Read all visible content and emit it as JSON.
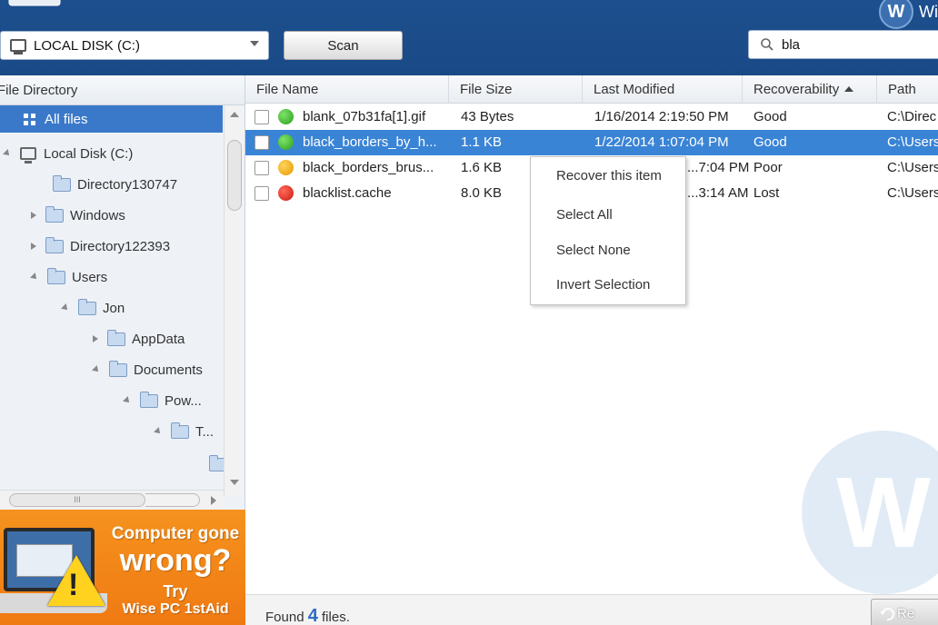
{
  "header": {
    "brand_badge": "W",
    "brand_name": "Wi",
    "drive_select": {
      "value": "LOCAL DISK (C:)"
    },
    "scan_label": "Scan",
    "search_value": "bla"
  },
  "sidebar": {
    "heading": "File Directory",
    "all_files": "All files",
    "tree": [
      {
        "label": "Local Disk (C:)"
      },
      {
        "label": "Directory130747"
      },
      {
        "label": "Windows"
      },
      {
        "label": "Directory122393"
      },
      {
        "label": "Users"
      },
      {
        "label": "Jon"
      },
      {
        "label": "AppData"
      },
      {
        "label": "Documents"
      },
      {
        "label": "Pow..."
      },
      {
        "label": "T..."
      }
    ],
    "hscroll_grip": "III"
  },
  "ad": {
    "line1": "Computer gone",
    "line2": "wrong?",
    "line3": "Try",
    "line4": "Wise PC 1stAid"
  },
  "table": {
    "columns": [
      "File Name",
      "File Size",
      "Last Modified",
      "Recoverability",
      "Path"
    ],
    "rows": [
      {
        "name": "blank_07b31fa[1].gif",
        "size": "43 Bytes",
        "modified": "1/16/2014 2:19:50 PM",
        "recoverability": "Good",
        "path": "C:\\Direc"
      },
      {
        "name": "black_borders_by_h...",
        "size": "1.1 KB",
        "modified": "1/22/2014 1:07:04 PM",
        "recoverability": "Good",
        "path": "C:\\Users"
      },
      {
        "name": "black_borders_brus...",
        "size": "1.6 KB",
        "modified": "...7:04 PM",
        "recoverability": "Poor",
        "path": "C:\\Users"
      },
      {
        "name": "blacklist.cache",
        "size": "8.0 KB",
        "modified": "...3:14 AM",
        "recoverability": "Lost",
        "path": "C:\\Users"
      }
    ]
  },
  "context_menu": {
    "items": [
      "Recover this item",
      "Select All",
      "Select None",
      "Invert Selection"
    ]
  },
  "status": {
    "found_prefix": "Found",
    "found_count": "4",
    "found_suffix": "files.",
    "recover_label": "Re"
  },
  "watermark": "W",
  "colors": {
    "header_bg": "#1b4b88",
    "selection": "#3a84d6",
    "good": "#2a9e1e",
    "poor": "#e69a00",
    "lost": "#cc1a10",
    "ad_bg": "#f28615"
  }
}
